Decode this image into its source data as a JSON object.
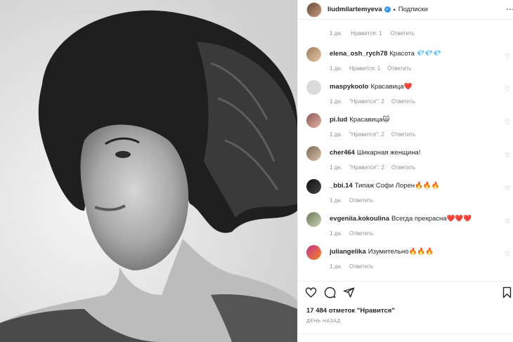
{
  "post": {
    "username": "liudmilartemyeva",
    "follow_label": "Подписки",
    "separator": "•"
  },
  "comments_top": {
    "time": "1 дн.",
    "likes": "Нравится: 1",
    "reply": "Ответить"
  },
  "comments": [
    {
      "user": "elena_osh_rych78",
      "text": "Красота 💎💎💎",
      "time": "1 дн.",
      "likes": "Нравится: 1",
      "reply": "Ответить"
    },
    {
      "user": "maspykoolo",
      "text": "Красавица❤️",
      "time": "1 дн.",
      "likes": "\"Нравится\": 2",
      "reply": "Ответить"
    },
    {
      "user": "pi.lud",
      "text": "Красавица🙀",
      "time": "1 дн.",
      "likes": "\"Нравится\": 2",
      "reply": "Ответить"
    },
    {
      "user": "cher464",
      "text": "Шикарная женщина!",
      "time": "1 дн.",
      "likes": "\"Нравится\": 2",
      "reply": "Ответить"
    },
    {
      "user": "_bbi.14",
      "text": "Типаж Софи Лорен🔥🔥🔥",
      "time": "1 дн.",
      "likes": "",
      "reply": "Ответить"
    },
    {
      "user": "evgeniia.kokoulina",
      "text": "Всегда прекрасна❤️❤️❤️",
      "time": "1 дн.",
      "likes": "",
      "reply": "Ответить"
    },
    {
      "user": "juliangelika",
      "text": "Изумительно🔥🔥🔥",
      "time": "1 дн.",
      "likes": "",
      "reply": "Ответить"
    }
  ],
  "footer": {
    "likes_count": "17 484 отметок \"Нравится\"",
    "date": "ДЕНЬ НАЗАД"
  },
  "colors": {
    "text": "#262626",
    "muted": "#8e8e8e",
    "verified": "#3897f0",
    "heart": "#ed4956"
  },
  "icons": [
    "verified-icon",
    "more-icon",
    "like-icon",
    "comment-icon",
    "share-icon",
    "bookmark-icon",
    "heart-small-icon"
  ]
}
